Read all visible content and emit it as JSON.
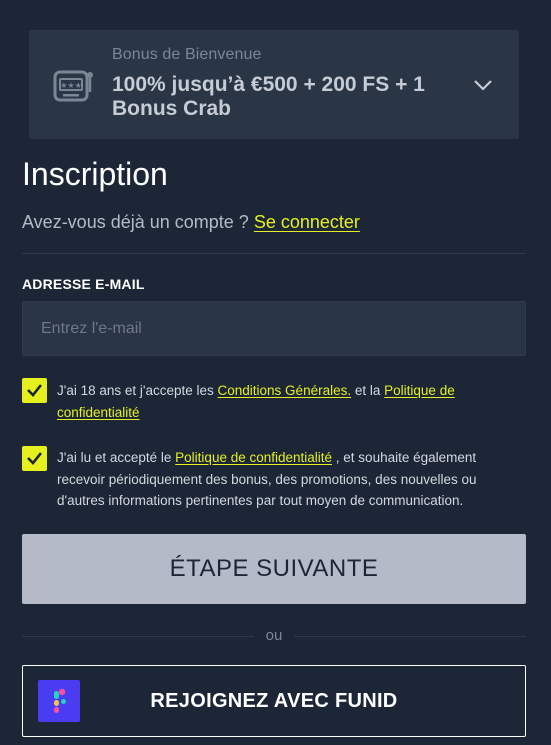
{
  "bonus": {
    "label": "Bonus de Bienvenue",
    "offer": "100% jusqu’à €500 + 200 FS + 1 Bonus Crab",
    "icon": "slot-machine-icon"
  },
  "form": {
    "title": "Inscription",
    "login_prompt": "Avez-vous déjà un compte ?",
    "login_link": "Se connecter",
    "email_label": "ADRESSE E-MAIL",
    "email_value": "",
    "email_placeholder": "Entrez l'e-mail",
    "consent_terms": {
      "checked": true,
      "text_before": "J'ai 18 ans et j'accepte les",
      "link1": "Conditions Générales.",
      "text_middle": "et la",
      "link2": "Politique de confidentialité"
    },
    "consent_marketing": {
      "checked": true,
      "text_before": "J'ai lu et accepté le",
      "link": "Politique de confidentialité",
      "text_after": ", et souhaite également recevoir périodiquement des bonus, des promotions, des nouvelles ou d'autres informations pertinentes par tout moyen de communication."
    },
    "next_button": "ÉTAPE SUIVANTE",
    "or_text": "ou",
    "funid_button": "REJOIGNEZ AVEC FUNID"
  },
  "colors": {
    "background": "#1c2637",
    "card": "#2a3546",
    "accent": "#e6f01e",
    "button_disabled": "#b4bac8",
    "funid_brand": "#4a3cf0"
  }
}
